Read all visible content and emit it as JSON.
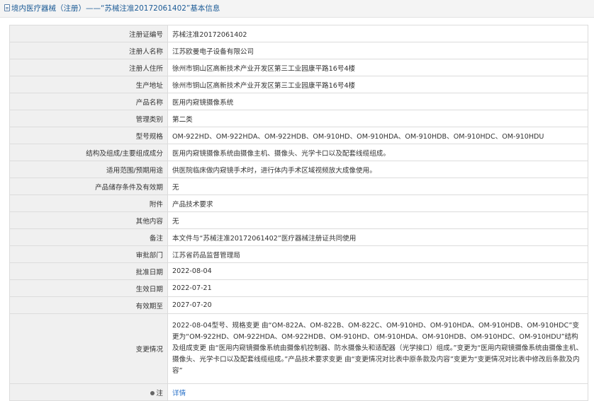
{
  "header": {
    "title": "境内医疗器械（注册）——“苏械注准20172061402”基本信息"
  },
  "rows": [
    {
      "label": "注册证编号",
      "value": "苏械注准20172061402"
    },
    {
      "label": "注册人名称",
      "value": "江苏欧曼电子设备有限公司"
    },
    {
      "label": "注册人住所",
      "value": "徐州市铜山区高新技术产业开发区第三工业园康平路16号4楼"
    },
    {
      "label": "生产地址",
      "value": "徐州市铜山区高新技术产业开发区第三工业园康平路16号4楼"
    },
    {
      "label": "产品名称",
      "value": "医用内窥镜摄像系统"
    },
    {
      "label": "管理类别",
      "value": "第二类"
    },
    {
      "label": "型号规格",
      "value": "OM-922HD、OM-922HDA、OM-922HDB、OM-910HD、OM-910HDA、OM-910HDB、OM-910HDC、OM-910HDU"
    },
    {
      "label": "结构及组成/主要组成成分",
      "value": "医用内窥镜摄像系统由摄像主机、摄像头、光学卡口以及配套线缆组成。"
    },
    {
      "label": "适用范围/预期用途",
      "value": "供医院临床做内窥镜手术时，进行体内手术区域视频放大成像使用。"
    },
    {
      "label": "产品储存条件及有效期",
      "value": "无"
    },
    {
      "label": "附件",
      "value": "产品技术要求"
    },
    {
      "label": "其他内容",
      "value": "无"
    },
    {
      "label": "备注",
      "value": "本文件与“苏械注准20172061402”医疗器械注册证共同使用"
    },
    {
      "label": "审批部门",
      "value": "江苏省药品监督管理局"
    },
    {
      "label": "批准日期",
      "value": "2022-08-04"
    },
    {
      "label": "生效日期",
      "value": "2022-07-21"
    },
    {
      "label": "有效期至",
      "value": "2027-07-20"
    }
  ],
  "change": {
    "label": "变更情况",
    "value": "2022-08-04型号、规格变更 由“OM-822A、OM-822B、OM-822C、OM-910HD、OM-910HDA、OM-910HDB、OM-910HDC”变更为“OM-922HD、OM-922HDA、OM-922HDB、OM-910HD、OM-910HDA、OM-910HDB、OM-910HDC、OM-910HDU”结构及组成变更 由“医用内窥镜摄像系统由摄像机控制器、防水摄像头和适配器（光学接口）组成。”变更为“医用内窥镜摄像系统由摄像主机、摄像头、光学卡口以及配套线缆组成。”产品技术要求变更 由“变更情况对比表中原条款及内容”变更为“变更情况对比表中修改后条款及内容”"
  },
  "note": {
    "label": "注",
    "link_text": "详情",
    "icon": "note-icon"
  }
}
